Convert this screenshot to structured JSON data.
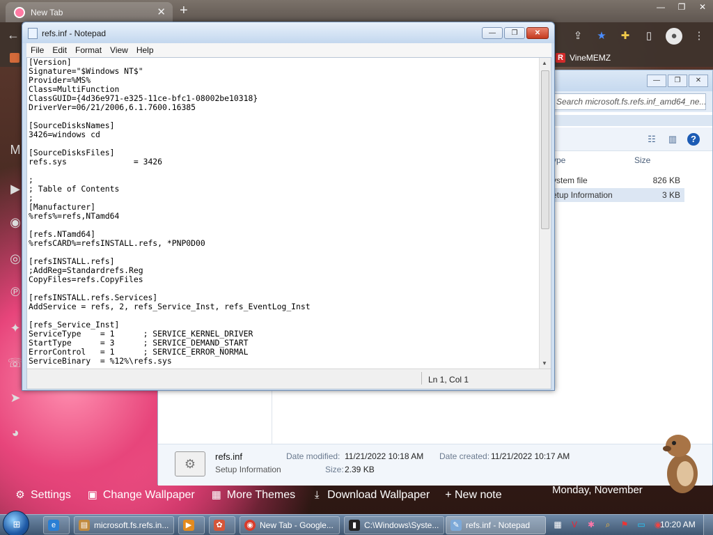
{
  "browser": {
    "tab_title": "New Tab",
    "bookmark": "VineMEMZ"
  },
  "explorer": {
    "search_placeholder": "Search microsoft.fs.refs.inf_amd64_ne...",
    "columns": {
      "type": "ype",
      "size": "Size"
    },
    "rows": [
      {
        "type": "ystem file",
        "size": "826 KB"
      },
      {
        "type": "etup Information",
        "size": "3 KB"
      }
    ],
    "details": {
      "name": "refs.inf",
      "kind": "Setup Information",
      "modified_label": "Date modified:",
      "modified_value": "11/21/2022 10:18 AM",
      "size_label": "Size:",
      "size_value": "2.39 KB",
      "created_label": "Date created:",
      "created_value": "11/21/2022 10:17 AM"
    }
  },
  "notepad": {
    "title": "refs.inf - Notepad",
    "menu": [
      "File",
      "Edit",
      "Format",
      "View",
      "Help"
    ],
    "content": "[Version]\nSignature=\"$Windows NT$\"\nProvider=%MS%\nClass=MultiFunction\nClassGUID={4d36e971-e325-11ce-bfc1-08002be10318}\nDriverVer=06/21/2006,6.1.7600.16385\n\n[SourceDisksNames]\n3426=windows cd\n\n[SourceDisksFiles]\nrefs.sys              = 3426\n\n;\n; Table of Contents\n;\n[Manufacturer]\n%refs%=refs,NTamd64\n\n[refs.NTamd64]\n%refsCARD%=refsINSTALL.refs, *PNP0D00\n\n[refsINSTALL.refs]\n;AddReg=Standardrefs.Reg\nCopyFiles=refs.CopyFiles\n\n[refsINSTALL.refs.Services]\nAddService = refs, 2, refs_Service_Inst, refs_EventLog_Inst\n\n[refs_Service_Inst]\nServiceType    = 1      ; SERVICE_KERNEL_DRIVER\nStartType      = 3      ; SERVICE_DEMAND_START\nErrorControl   = 1      ; SERVICE_ERROR_NORMAL\nServiceBinary  = %12%\\refs.sys",
    "status": "Ln 1, Col 1"
  },
  "ntp": {
    "settings": "Settings",
    "change_wallpaper": "Change Wallpaper",
    "more_themes": "More Themes",
    "download_wallpaper": "Download Wallpaper",
    "new_note": "+ New note",
    "date": "Monday, November"
  },
  "taskbar": {
    "items": [
      "microsoft.fs.refs.in...",
      "New Tab - Google...",
      "C:\\Windows\\Syste...",
      "refs.inf - Notepad"
    ],
    "time": "10:20 AM"
  }
}
